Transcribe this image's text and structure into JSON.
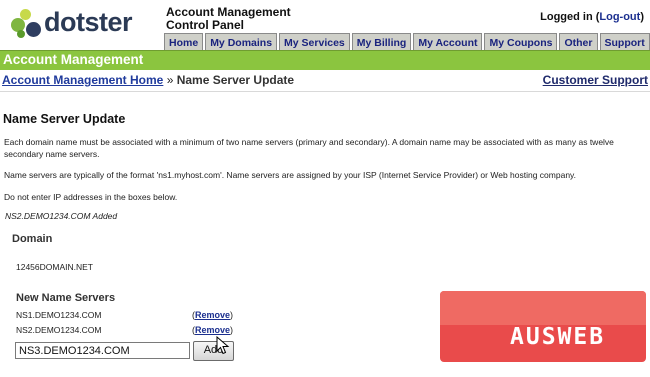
{
  "header": {
    "logo_text": "dotster",
    "app_title_line1": "Account Management",
    "app_title_line2": "Control Panel",
    "login_text": "Logged in (",
    "logout_link": "Log-out",
    "login_close": ")"
  },
  "tabs": [
    "Home",
    "My Domains",
    "My Services",
    "My Billing",
    "My Account",
    "My Coupons",
    "Other",
    "Support"
  ],
  "section_bar": {
    "title": "Account Management"
  },
  "breadcrumb": {
    "home_link": "Account Management Home",
    "separator": " » ",
    "current": "Name Server Update"
  },
  "customer_support_link": "Customer Support",
  "main": {
    "title": "Name Server Update",
    "paragraph1": "Each domain name must be associated with a minimum of two name servers (primary and secondary). A domain name may be associated with as many as twelve secondary name servers.",
    "paragraph2": "Name servers are typically of the format 'ns1.myhost.com'. Name servers are assigned by your ISP (Internet Service Provider) or Web hosting company.",
    "paragraph3": "Do not enter IP addresses in the boxes below.",
    "status_message": "NS2.DEMO1234.COM Added",
    "domain_label": "Domain",
    "domain_value": "12456DOMAIN.NET",
    "name_servers_label": "New Name Servers",
    "name_servers": [
      {
        "name": "NS1.DEMO1234.COM",
        "action_open": "(",
        "action": "Remove",
        "action_close": ")"
      },
      {
        "name": "NS2.DEMO1234.COM",
        "action_open": "(",
        "action": "Remove",
        "action_close": ")"
      }
    ],
    "new_ns_input_value": "NS3.DEMO1234.COM",
    "add_button_label": "Add"
  },
  "watermark": {
    "text": "AUSWEB"
  },
  "colors": {
    "green_bar": "#8bc53f",
    "tab_bg": "#cfd0c9",
    "link_blue": "#1b2f8f",
    "watermark_red": "#e94b4b"
  },
  "icons": {
    "logo": "dotster-logo-dots",
    "cursor": "mouse-pointer-icon"
  }
}
